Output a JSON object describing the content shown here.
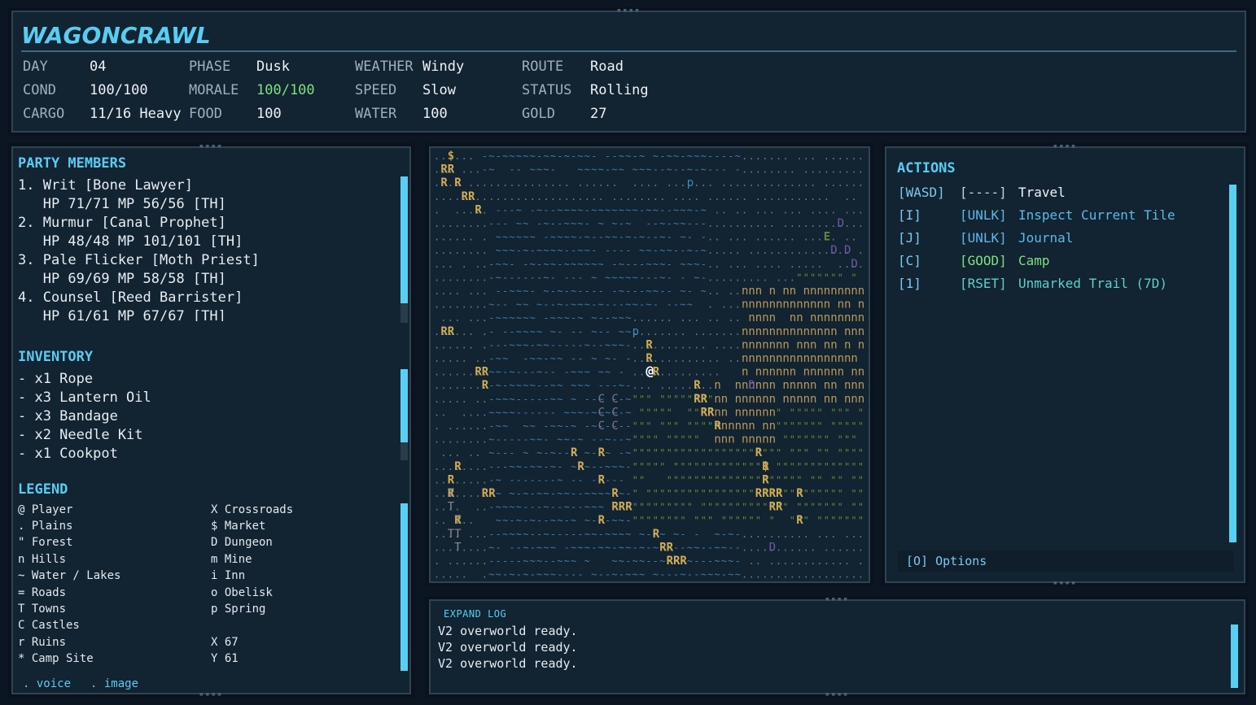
{
  "app": {
    "title": "WAGONCRAWL"
  },
  "stats": {
    "day_label": "DAY",
    "day": "04",
    "phase_label": "PHASE",
    "phase": "Dusk",
    "weather_label": "WEATHER",
    "weather": "Windy",
    "route_label": "ROUTE",
    "route": "Road",
    "cond_label": "COND",
    "cond": "100/100",
    "morale_label": "MORALE",
    "morale": "100/100",
    "speed_label": "SPEED",
    "speed": "Slow",
    "status_label": "STATUS",
    "status": "Rolling",
    "cargo_label": "CARGO",
    "cargo": "11/16 Heavy",
    "food_label": "FOOD",
    "food": "100",
    "water_label": "WATER",
    "water": "100",
    "gold_label": "GOLD",
    "gold": "27"
  },
  "party": {
    "title": "PARTY MEMBERS",
    "members": [
      {
        "name": "1. Writ [Bone Lawyer]",
        "stats": "   HP 71/71 MP 56/56 [TH]"
      },
      {
        "name": "2. Murmur [Canal Prophet]",
        "stats": "   HP 48/48 MP 101/101 [TH]"
      },
      {
        "name": "3. Pale Flicker [Moth Priest]",
        "stats": "   HP 69/69 MP 58/58 [TH]"
      },
      {
        "name": "4. Counsel [Reed Barrister]",
        "stats": "   HP 61/61 MP 67/67 [TH]"
      }
    ]
  },
  "inventory": {
    "title": "INVENTORY",
    "items": [
      "- x1 Rope",
      "- x3 Lantern Oil",
      "- x3 Bandage",
      "- x2 Needle Kit",
      "- x1 Cookpot"
    ]
  },
  "legend": {
    "title": "LEGEND",
    "left": [
      "@ Player",
      ". Plains",
      "\" Forest",
      "n Hills",
      "~ Water / Lakes",
      "= Roads",
      "T Towns",
      "C Castles",
      "r Ruins",
      "* Camp Site"
    ],
    "right": [
      "X Crossroads",
      "$ Market",
      "D Dungeon",
      "m Mine",
      "i Inn",
      "o Obelisk",
      "p Spring",
      "",
      "X 67",
      "Y 61"
    ],
    "voice": ". voice",
    "image": ". image"
  },
  "actions": {
    "title": "ACTIONS",
    "rows": [
      {
        "key": "[WASD]",
        "tag": "[----]",
        "label": "Travel",
        "tag_color": "#c8d2da",
        "label_color": "#eef3f7"
      },
      {
        "key": "[I]",
        "tag": "[UNLK]",
        "label": "Inspect Current Tile",
        "tag_color": "#5fb8ea",
        "label_color": "#5fb8ea"
      },
      {
        "key": "[J]",
        "tag": "[UNLK]",
        "label": "Journal",
        "tag_color": "#5fb8ea",
        "label_color": "#5fb8ea"
      },
      {
        "key": "[C]",
        "tag": "[GOOD]",
        "label": "Camp",
        "tag_color": "#7ee07e",
        "label_color": "#7ee07e"
      },
      {
        "key": "[1]",
        "tag": "[RSET]",
        "label": "Unmarked Trail (7D)",
        "tag_color": "#5fd0c8",
        "label_color": "#5fd0c8"
      }
    ],
    "options": "[O] Options"
  },
  "log": {
    "title": "EXPAND LOG",
    "lines": [
      "V2 overworld ready.",
      "V2 overworld ready.",
      "V2 overworld ready."
    ]
  },
  "map": {
    "player_glyph": "@",
    "colors": {
      "plains": "#6a7d8c",
      "water": "#3c7fae",
      "forest": "#5f8a3a",
      "hills": "#b99a5a",
      "ruins": "#d1ad55",
      "dungeon": "#6c5aa8",
      "market": "#c9a44b",
      "spring": "#3c8fb8",
      "player": "#ffffff"
    }
  },
  "theme": {
    "accent": "#58cdf2",
    "panel": "#122331",
    "border": "#2e4454",
    "good": "#7ee07e"
  }
}
